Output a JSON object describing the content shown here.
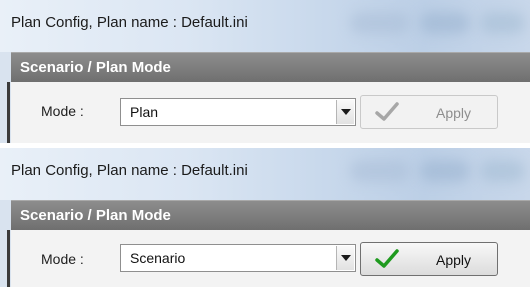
{
  "panels": [
    {
      "window_title": "Plan Config, Plan name : Default.ini",
      "section_header": "Scenario / Plan Mode",
      "mode_label": "Mode :",
      "mode_value": "Plan",
      "apply_label": "Apply",
      "apply_enabled": false,
      "check_icon": "checkmark-icon",
      "check_color": "#a7a7a7"
    },
    {
      "window_title": "Plan Config, Plan name : Default.ini",
      "section_header": "Scenario / Plan Mode",
      "mode_label": "Mode :",
      "mode_value": "Scenario",
      "apply_label": "Apply",
      "apply_enabled": true,
      "check_icon": "checkmark-icon",
      "check_color": "#1f9a1f"
    }
  ]
}
